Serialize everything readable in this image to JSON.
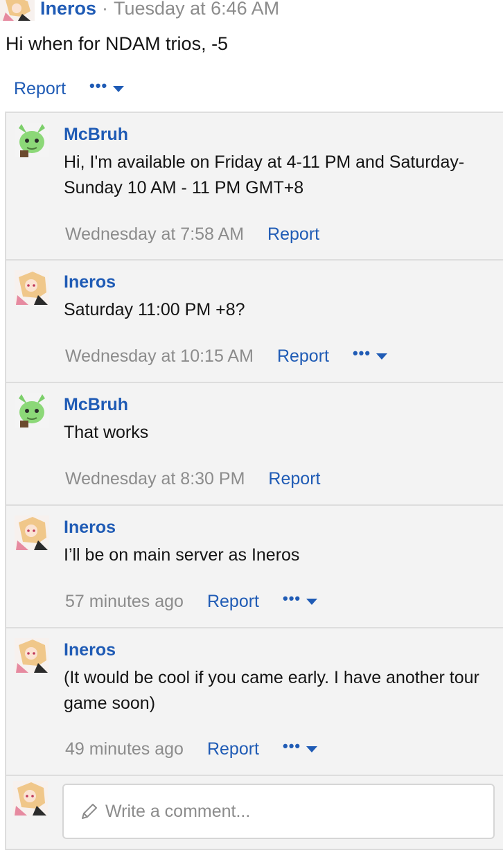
{
  "post": {
    "author": "Ineros",
    "separator": "·",
    "time": "Tuesday at 6:46 AM",
    "body": "Hi when for NDAM trios, -5",
    "report_label": "Report",
    "more_dots": "•••"
  },
  "comments": [
    {
      "author": "McBruh",
      "avatar": "green-creature-avatar",
      "text": "Hi, I'm available on Friday at 4-11 PM and Saturday-Sunday 10 AM - 11 PM GMT+8",
      "time": "Wednesday at 7:58 AM",
      "report_label": "Report",
      "has_more": false
    },
    {
      "author": "Ineros",
      "avatar": "anime-girl-avatar",
      "text": "Saturday 11:00 PM +8?",
      "time": "Wednesday at 10:15 AM",
      "report_label": "Report",
      "has_more": true
    },
    {
      "author": "McBruh",
      "avatar": "green-creature-avatar",
      "text": "That works",
      "time": "Wednesday at 8:30 PM",
      "report_label": "Report",
      "has_more": false
    },
    {
      "author": "Ineros",
      "avatar": "anime-girl-avatar",
      "text": "I’ll be on main server as Ineros",
      "time": "57 minutes ago",
      "report_label": "Report",
      "has_more": true
    },
    {
      "author": "Ineros",
      "avatar": "anime-girl-avatar",
      "text": "(It would be cool if you came early. I have another tour game soon)",
      "time": "49 minutes ago",
      "report_label": "Report",
      "has_more": true
    }
  ],
  "reply": {
    "placeholder": "Write a comment..."
  },
  "more_dots": "•••",
  "colors": {
    "link": "#1f5bb5",
    "muted": "#8c8c8c",
    "panel_bg": "#f3f3f3",
    "border": "#dddddd"
  }
}
